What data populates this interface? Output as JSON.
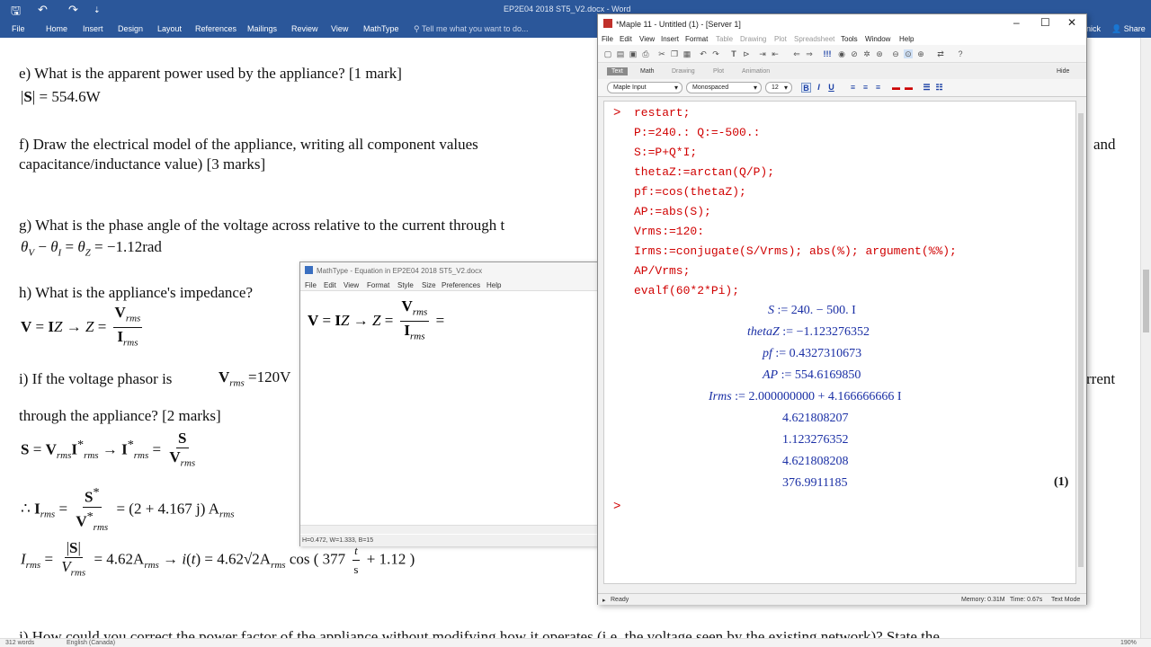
{
  "word": {
    "title": "EP2E04 2018 ST5_V2.docx - Word",
    "tabs": [
      "File",
      "Home",
      "Insert",
      "Design",
      "Layout",
      "References",
      "Mailings",
      "Review",
      "View",
      "MathType"
    ],
    "tell_me": "Tell me what you want to do...",
    "user": "nick",
    "share": "Share",
    "questions": {
      "e": "e) What is the apparent power used by the appliance? [1 mark]",
      "f1": "f) Draw the electrical model of the appliance, writing all component values",
      "f1b": "and",
      "f2": "capacitance/inductance value) [3 marks]",
      "g": "g) What is the phase angle of the voltage across relative to the current through t",
      "h": "h) What is the appliance's impedance?",
      "i1": "i) If the voltage phasor is",
      "i1b": "rrent",
      "i2": "through the appliance? [2 marks]",
      "j": "j) How could you correct the power factor of the appliance without modifying how it operates (i.e. the voltage seen by the existing network)? State the"
    },
    "eq": {
      "e_val": "554.6W",
      "g_val": "−1.12rad",
      "i_volt": "=120V",
      "i_current": "(2 + 4.167 j) A",
      "i_mag": "4.62A",
      "i_time": "4.62√2A",
      "i_freq": "377",
      "i_phase": "+ 1.12"
    },
    "status": {
      "words": "312 words",
      "language": "English (Canada)",
      "zoom": "190%"
    }
  },
  "mathtype": {
    "title": "MathType - Equation in EP2E04 2018 ST5_V2.docx",
    "menu": [
      "File",
      "Edit",
      "View",
      "Format",
      "Style",
      "Size",
      "Preferences",
      "Help"
    ],
    "status": "H=0.472, W=1.333, B=15"
  },
  "maple": {
    "title": "*Maple 11 - Untitled (1) - [Server 1]",
    "menu": [
      "File",
      "Edit",
      "View",
      "Insert",
      "Format",
      "Table",
      "Drawing",
      "Plot",
      "Spreadsheet",
      "Tools",
      "Window",
      "Help"
    ],
    "tabs": [
      "Text",
      "Math",
      "Drawing",
      "Plot",
      "Animation"
    ],
    "hide": "Hide",
    "input_mode": "Maple Input",
    "font": "Monospaced",
    "font_size": "12",
    "prompt": ">",
    "code": [
      "restart;",
      "P:=240.: Q:=-500.:",
      "S:=P+Q*I;",
      "thetaZ:=arctan(Q/P);",
      "pf:=cos(thetaZ);",
      "AP:=abs(S);",
      "Vrms:=120:",
      "Irms:=conjugate(S/Vrms); abs(%); argument(%%);",
      "AP/Vrms;",
      "evalf(60*2*Pi);"
    ],
    "outputs": {
      "S_name": "S",
      "S_val": ":= 240. − 500. I",
      "thetaZ_name": "thetaZ",
      "thetaZ_val": ":= −1.123276352",
      "pf_name": "pf",
      "pf_val": ":= 0.4327310673",
      "AP_name": "AP",
      "AP_val": ":= 554.6169850",
      "Irms_name": "Irms",
      "Irms_val": ":= 2.000000000 + 4.166666666 I",
      "v1": "4.621808207",
      "v2": "1.123276352",
      "v3": "4.621808208",
      "v4": "376.9911185"
    },
    "eq_label": "(1)",
    "status": {
      "ready": "Ready",
      "memory": "Memory: 0.31M",
      "time": "Time: 0.67s",
      "mode": "Text Mode"
    }
  }
}
